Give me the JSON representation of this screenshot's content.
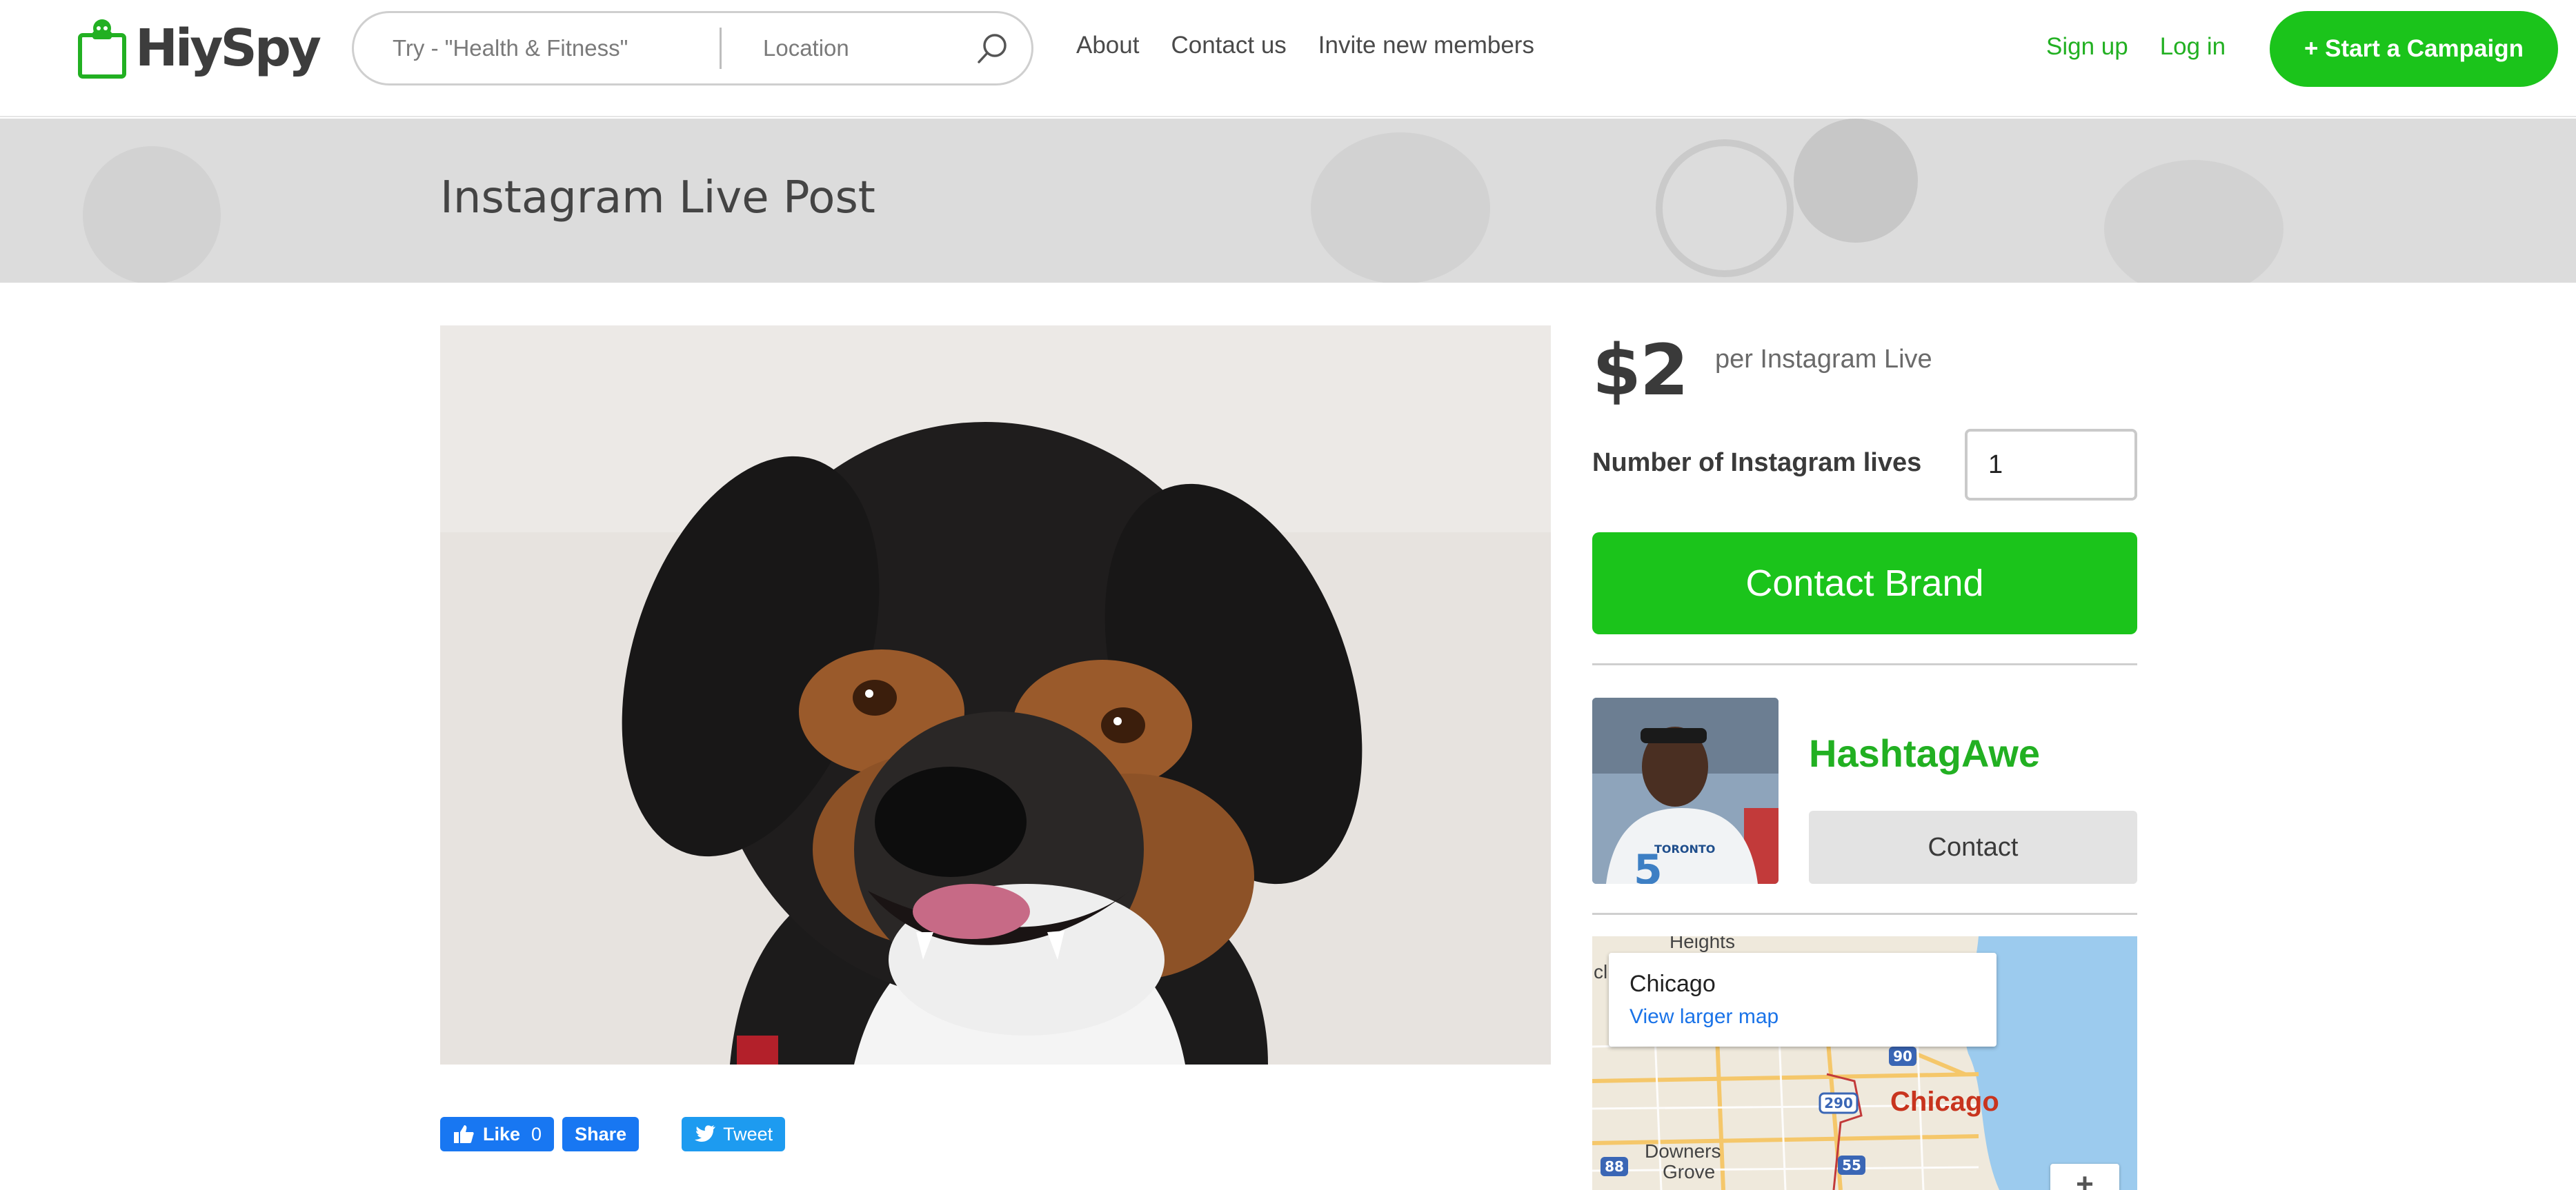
{
  "brand": {
    "name": "HiySpy",
    "accent": "#1bc41b"
  },
  "search": {
    "what_placeholder": "Try - \"Health & Fitness\"",
    "location_placeholder": "Location"
  },
  "nav": {
    "items": [
      "About",
      "Contact us",
      "Invite new members"
    ]
  },
  "auth": {
    "signup": "Sign up",
    "login": "Log in"
  },
  "cta": {
    "label": "+ Start a Campaign"
  },
  "banner": {
    "title": "Instagram Live Post"
  },
  "listing": {
    "price": "$2",
    "per": "per Instagram Live",
    "qty_label": "Number of Instagram lives",
    "qty_value": "1",
    "contact_brand": "Contact Brand"
  },
  "influencer": {
    "handle": "HashtagAwe",
    "contact": "Contact"
  },
  "map": {
    "card_title": "Chicago",
    "card_link": "View larger map",
    "labels": {
      "heights": "Heights",
      "cl": "cl",
      "downers": "Downers",
      "grove": "Grove",
      "city": "Chicago"
    },
    "shields": [
      "90",
      "290",
      "88",
      "55"
    ],
    "zoom": "+"
  },
  "share": {
    "like": "Like",
    "like_count": "0",
    "share": "Share",
    "tweet": "Tweet"
  }
}
